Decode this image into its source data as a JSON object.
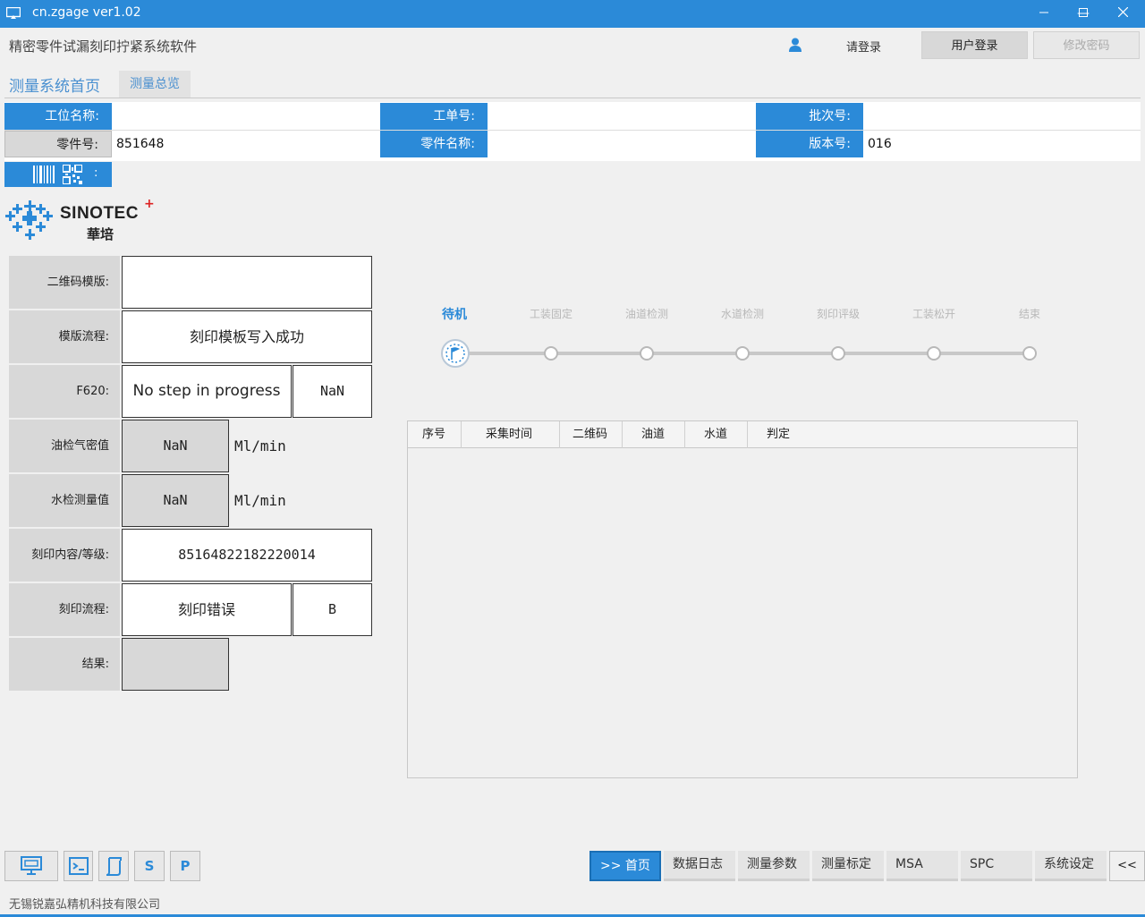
{
  "window": {
    "title": "cn.zgage ver1.02",
    "minimize": "—",
    "maximize": "☐",
    "close": "✕"
  },
  "header": {
    "app_title": "精密零件试漏刻印拧紧系统软件",
    "login_hint": "请登录",
    "login_button": "用户登录",
    "change_password_button": "修改密码"
  },
  "tabs": {
    "home": "测量系统首页",
    "overview": "测量总览"
  },
  "info": {
    "station_label": "工位名称:",
    "station_value": "",
    "order_label": "工单号:",
    "order_value": "",
    "batch_label": "批次号:",
    "batch_value": "",
    "part_no_label": "零件号:",
    "part_no_value": "851648",
    "part_name_label": "零件名称:",
    "part_name_value": "",
    "version_label": "版本号:",
    "version_value": "016",
    "barcode_label": ":"
  },
  "logo": {
    "brand": "SINOTEC",
    "brand_cn": "華培",
    "plus": "+"
  },
  "fields": {
    "qr_template_label": "二维码模版:",
    "qr_template_value": "",
    "template_flow_label": "模版流程:",
    "template_flow_value": "刻印模板写入成功",
    "f620_label": "F620:",
    "f620_status": "No step in progress",
    "f620_value": "NaN",
    "oil_label": "油检气密值",
    "oil_value": "NaN",
    "oil_unit": "Ml/min",
    "water_label": "水检测量值",
    "water_value": "NaN",
    "water_unit": "Ml/min",
    "mark_content_label": "刻印内容/等级:",
    "mark_content_value": "85164822182220014",
    "mark_flow_label": "刻印流程:",
    "mark_flow_value": "刻印错误",
    "mark_grade": "B",
    "result_label": "结果:",
    "result_value": ""
  },
  "steps": [
    "待机",
    "工装固定",
    "油道检测",
    "水道检测",
    "刻印评级",
    "工装松开",
    "结束"
  ],
  "table": {
    "columns": [
      "序号",
      "采集时间",
      "二维码",
      "油道",
      "水道",
      "判定"
    ],
    "rows": []
  },
  "toolbar": {
    "s_label": "S",
    "p_label": "P",
    "nav": [
      ">> 首页",
      "数据日志",
      "测量参数",
      "测量标定",
      "MSA",
      "SPC",
      "系统设定"
    ],
    "collapse": "<<"
  },
  "footer": {
    "company": "无锡锐嘉弘精机科技有限公司"
  },
  "colors": {
    "accent": "#2b8ad8",
    "panel": "#d8d8d8"
  }
}
